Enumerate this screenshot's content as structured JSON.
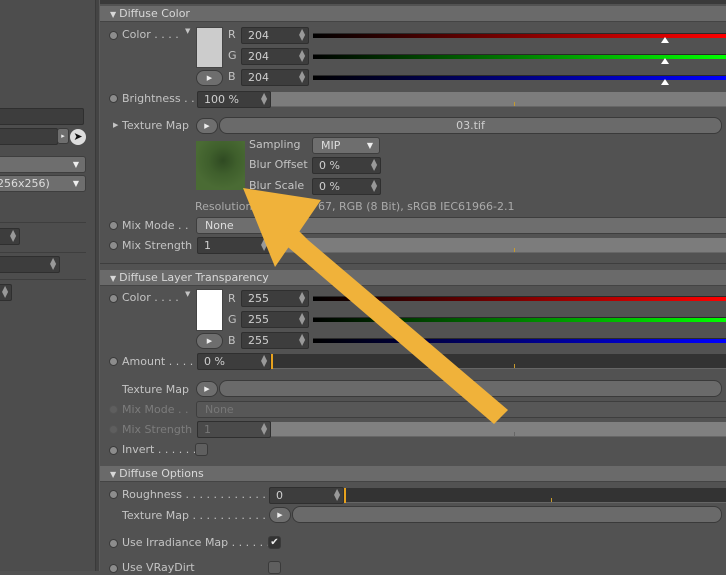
{
  "left_panel": {
    "texture_size_dropdown": "256x256)"
  },
  "diffuse_color": {
    "header": "Diffuse Color",
    "color_label": "Color . . . .",
    "swatch_color": "#cccccc",
    "r_label": "R",
    "g_label": "G",
    "b_label": "B",
    "r": "204",
    "g": "204",
    "b": "204",
    "brightness_label": "Brightness . .",
    "brightness": "100 %",
    "texture_map_label": "Texture Map",
    "texture_file": "03.tif",
    "sampling_label": "Sampling",
    "sampling": "MIP",
    "blur_offset_label": "Blur Offset",
    "blur_offset": "0 %",
    "blur_scale_label": "Blur Scale",
    "blur_scale": "0 %",
    "resolution_visible_start": "Resolution 1",
    "resolution_visible_end": "67, RGB (8 Bit), sRGB IEC61966-2.1",
    "mix_mode_label": "Mix Mode . .",
    "mix_mode": "None",
    "mix_strength_label": "Mix Strength",
    "mix_strength": "1"
  },
  "diffuse_layer_transparency": {
    "header": "Diffuse Layer Transparency",
    "color_label": "Color . . . .",
    "swatch_color": "#ffffff",
    "r_label": "R",
    "g_label": "G",
    "b_label": "B",
    "r": "255",
    "g": "255",
    "b": "255",
    "amount_label": "Amount . . . .",
    "amount": "0 %",
    "texture_map_label": "Texture Map",
    "mix_mode_label": "Mix Mode . .",
    "mix_mode": "None",
    "mix_strength_label": "Mix Strength",
    "mix_strength": "1",
    "invert_label": "Invert . . . . . .",
    "invert": false
  },
  "diffuse_options": {
    "header": "Diffuse Options",
    "roughness_label": "Roughness . . . . . . . . . . . . .",
    "roughness": "0",
    "texture_map_label": "Texture Map . . . . . . . . . . . .",
    "use_irradiance_map_label": "Use Irradiance Map . . . . . .",
    "use_irradiance_map": true,
    "use_vraydirt_label": "Use VRayDirt",
    "use_vraydirt": false
  },
  "icons": {
    "collapse": "▾",
    "expand": "▸",
    "spinner": "⇕",
    "check": "✔"
  },
  "colors": {
    "annotation_arrow": "#f0b23a",
    "slider_marker": "#e7a21e"
  }
}
